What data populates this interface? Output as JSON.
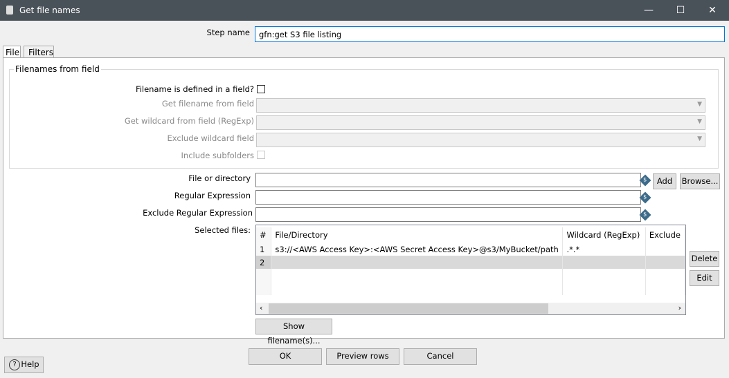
{
  "window": {
    "title": "Get file names",
    "minimize": "—",
    "maximize": "☐",
    "close": "✕"
  },
  "step_name": {
    "label": "Step name",
    "value": "gfn:get S3 file listing"
  },
  "tabs": [
    {
      "label": "File"
    },
    {
      "label": "Filters"
    }
  ],
  "group": {
    "title": "Filenames from field",
    "defined_in_field": "Filename is defined in a field?",
    "get_filename": "Get filename from field",
    "get_wildcard": "Get wildcard from field (RegExp)",
    "exclude_wildcard": "Exclude wildcard field",
    "include_subfolders": "Include subfolders"
  },
  "file_or_dir": {
    "label": "File or directory",
    "value": ""
  },
  "regex": {
    "label": "Regular Expression",
    "value": ""
  },
  "exclude_regex": {
    "label": "Exclude Regular Expression",
    "value": ""
  },
  "buttons": {
    "add": "Add",
    "browse": "Browse...",
    "delete": "Delete",
    "edit": "Edit",
    "show": "Show filename(s)...",
    "ok": "OK",
    "preview": "Preview rows",
    "cancel": "Cancel",
    "help": "Help"
  },
  "selected_files": {
    "label": "Selected files:",
    "columns": [
      "#",
      "File/Directory",
      "Wildcard (RegExp)",
      "Exclude"
    ],
    "rows": [
      [
        "1",
        "s3://<AWS Access Key>:<AWS Secret Access Key>@s3/MyBucket/path",
        ".*.*",
        ""
      ],
      [
        "2",
        "",
        "",
        ""
      ]
    ]
  }
}
